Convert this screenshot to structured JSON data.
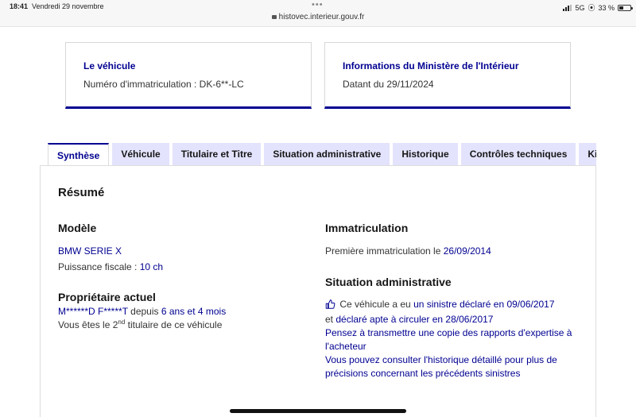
{
  "statusbar": {
    "time": "18:41",
    "date": "Vendredi 29 novembre",
    "url": "histovec.interieur.gouv.fr",
    "network": "5G",
    "battery": "33 %"
  },
  "cards": {
    "vehicle_title": "Le véhicule",
    "vehicle_text": "Numéro d'immatriculation : DK-6**-LC",
    "ministry_title": "Informations du Ministère de l'Intérieur",
    "ministry_text": "Datant du 29/11/2024"
  },
  "tabs": [
    "Synthèse",
    "Véhicule",
    "Titulaire et Titre",
    "Situation administrative",
    "Historique",
    "Contrôles techniques",
    "Kilo"
  ],
  "summary": {
    "title": "Résumé",
    "model_heading": "Modèle",
    "model_value": "BMW SERIE X",
    "power_label": "Puissance fiscale : ",
    "power_value": "10 ch",
    "owner_heading": "Propriétaire actuel",
    "owner_name": "M******D F*****T",
    "owner_since_label": " depuis ",
    "owner_since_value": "6 ans et 4 mois",
    "owner_rank_prefix": "Vous êtes le 2",
    "owner_rank_sup": "nd",
    "owner_rank_suffix": " titulaire de ce véhicule",
    "registration_heading": "Immatriculation",
    "first_reg_label": "Première immatriculation le ",
    "first_reg_value": "26/09/2014",
    "admin_heading": "Situation administrative",
    "admin_line1_prefix": " Ce véhicule a eu ",
    "admin_line1_link": "un sinistre déclaré en 09/06/2017",
    "admin_line2_prefix": "et ",
    "admin_line2_link": "déclaré apte à circuler en 28/06/2017",
    "admin_line3": "Pensez à transmettre une copie des rapports d'expertise à",
    "admin_line4": "l'acheteur",
    "admin_line5": "Vous pouvez consulter l'historique détaillé pour plus de",
    "admin_line6": "précisions concernant les précédents sinistres"
  },
  "colors": {
    "accent": "#000091",
    "tab_bg": "#e3e3fd"
  }
}
